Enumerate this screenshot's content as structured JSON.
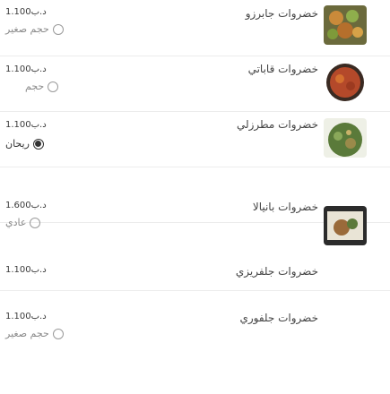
{
  "items": [
    {
      "price": "1.100د.ب",
      "size": "حجم صغير",
      "size_selected": false,
      "name": "خضروات جابرزو",
      "image_icon": "vegetable-dish-image"
    },
    {
      "price": "1.100د.ب",
      "size": "حجم",
      "size_selected": false,
      "name": "خضروات قاباتي",
      "image_icon": "vegetable-dish-image"
    },
    {
      "price": "1.100د.ب",
      "size": "ريحان",
      "size_selected": true,
      "name": "خضروات مطرزلي",
      "image_icon": "vegetable-dish-image"
    },
    {
      "price": "1.600د.ب",
      "size": "عادي",
      "size_selected": false,
      "name": "خضروات بانيالا",
      "image_icon": "vegetable-dish-image"
    },
    {
      "price": "1.100د.ب",
      "size": "",
      "size_selected": false,
      "name": "خضروات جلفريزي",
      "image_icon": ""
    },
    {
      "price": "1.100د.ب",
      "size": "حجم صغير",
      "size_selected": false,
      "name": "خضروات جلفوري",
      "image_icon": ""
    }
  ],
  "colors": {
    "text": "#3a3a3a",
    "muted": "#8a8a8a",
    "divider": "#ececec"
  }
}
